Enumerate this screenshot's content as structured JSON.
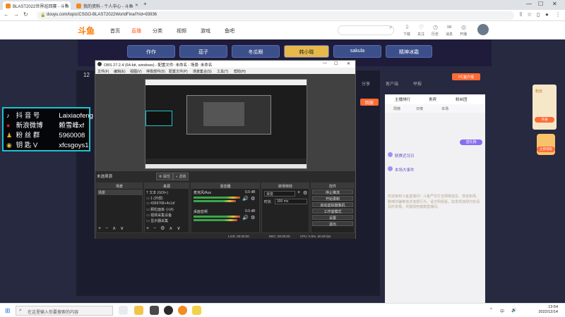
{
  "browser": {
    "tabs": [
      {
        "label": "BLAST2022世界巡回赛 - 斗鱼",
        "active": true
      },
      {
        "label": "我的资料 - 个人中心 - 斗鱼",
        "active": false
      }
    ],
    "new_tab": "+",
    "url": "douyu.com/topic/CSGO-BLAST2022WorldFinal?rid=93936"
  },
  "site": {
    "logo": "斗鱼",
    "nav": [
      "首页",
      "直播",
      "分类",
      "视频",
      "游戏",
      "鱼吧"
    ],
    "header_icons": [
      "下载",
      "关注",
      "历史",
      "消息",
      "开播"
    ],
    "team_tabs": [
      "作作",
      "茄子",
      "冬瓜眼",
      "韩小晓",
      "sakula",
      "精神冰霜"
    ],
    "active_team": "韩小晓",
    "room_num": "12",
    "side_labels": [
      "分享",
      "客户端",
      "举报"
    ],
    "pc_button": "PC客户端",
    "reply_btn": "回放",
    "chat_tabs": [
      "主播排行",
      "贵宾",
      "粉丝团"
    ],
    "chat_sub": [
      "周榜",
      "日榜",
      "本场"
    ],
    "send_gift": "送礼物",
    "news": [
      "联赛近况日",
      "本场大事件"
    ],
    "chat_text": "欢迎来到斗鱼直播间！斗鱼严厉打击网络谣言、低俗色情、赌博诈骗等违法违规行为，请文明观看。如发现违规内容请及时举报，共建绿色健康直播间。",
    "right_badge": "粉丝",
    "right_btn": "开通",
    "right_btn2": "立即领取"
  },
  "social": {
    "rows": [
      {
        "icon": "♪",
        "label": "抖 音 号",
        "value": "Laixiaofeng"
      },
      {
        "icon": "●",
        "label": "新浪微博",
        "value": "赖雪峰xf"
      },
      {
        "icon": "♟",
        "label": "粉 丝 群",
        "value": "5960008"
      },
      {
        "icon": "◉",
        "label": "钥 匙 V",
        "value": "xfcsgoys1"
      }
    ]
  },
  "obs": {
    "title": "OBS 27.2.4 (64-bit, windows) - 配置文件: 未命名 - 场景: 未命名",
    "menu": [
      "文件(F)",
      "编辑(E)",
      "视图(V)",
      "停靠部件(D)",
      "配置文件(P)",
      "场景集合(S)",
      "工具(T)",
      "帮助(H)"
    ],
    "scene_label": "未选择源",
    "props_btn": "属性",
    "filters_btn": "滤镜",
    "docks": {
      "scenes": {
        "title": "场景",
        "items": [
          "场景"
        ]
      },
      "sources": {
        "title": "来源",
        "items": [
          "文本 (GDI+)",
          "1 (外部)",
          "4399768+4x1xf",
          "颗粒面板 小(4)",
          "视频采集设备",
          "显示器采集"
        ]
      },
      "mixer": {
        "title": "混音器",
        "channels": [
          {
            "name": "麦克风/Aux",
            "db": "0.0 dB"
          },
          {
            "name": "桌面音频",
            "db": "0.0 dB"
          }
        ]
      },
      "transitions": {
        "title": "转场特效",
        "type": "渐变",
        "duration_label": "时长",
        "duration": "300 ms"
      },
      "controls": {
        "title": "控件",
        "buttons": [
          "停止推流",
          "开始录制",
          "启动虚拟摄像机",
          "工作室模式",
          "设置",
          "退出"
        ]
      }
    },
    "status": {
      "live": "LIVE: 00:00:00",
      "rec": "REC: 00:00:00",
      "cpu": "CPU: 0.5%, 60.00 fps"
    }
  },
  "taskbar": {
    "search_placeholder": "在这里输入你要搜索的内容",
    "tray": [
      "^",
      "中",
      "🔊"
    ],
    "time": "13:54",
    "date": "2022/12/14"
  }
}
